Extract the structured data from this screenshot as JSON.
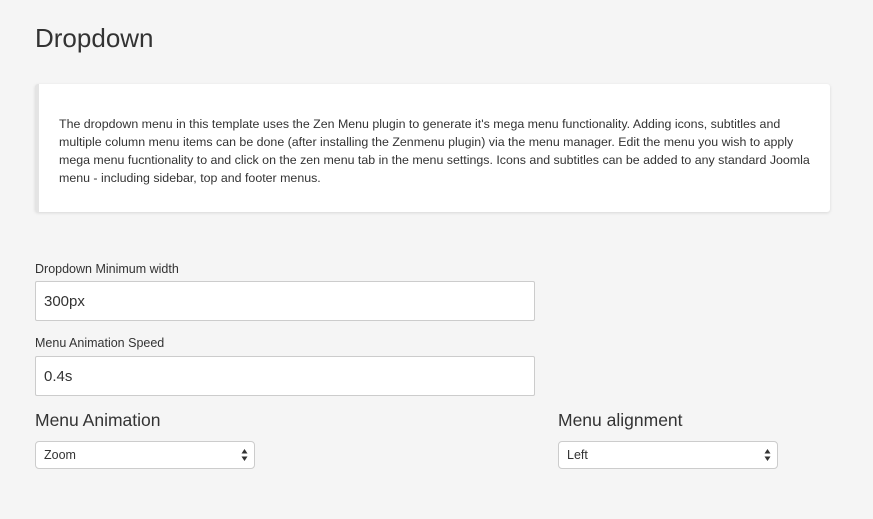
{
  "page": {
    "title": "Dropdown"
  },
  "info": {
    "text": "The dropdown menu in this template uses the Zen Menu plugin to generate it's mega menu functionality. Adding icons, subtitles and multiple column menu items can be done (after installing the Zenmenu plugin) via the menu manager. Edit the menu you wish to apply mega menu fucntionality to and click on the zen menu tab in the menu settings. Icons and subtitles can be added to any standard Joomla menu - including sidebar, top and footer menus."
  },
  "fields": {
    "dropdown_min_width": {
      "label": "Dropdown Minimum width",
      "value": "300px"
    },
    "menu_animation_speed": {
      "label": "Menu Animation Speed",
      "value": "0.4s"
    }
  },
  "selects": {
    "menu_animation": {
      "label": "Menu Animation",
      "value": "Zoom",
      "icon": "select-arrows-icon"
    },
    "menu_alignment": {
      "label": "Menu alignment",
      "value": "Left",
      "icon": "select-arrows-icon"
    }
  },
  "colors": {
    "background": "#f5f5f5",
    "panel": "#ffffff",
    "text": "#333333",
    "border": "#cccccc"
  }
}
